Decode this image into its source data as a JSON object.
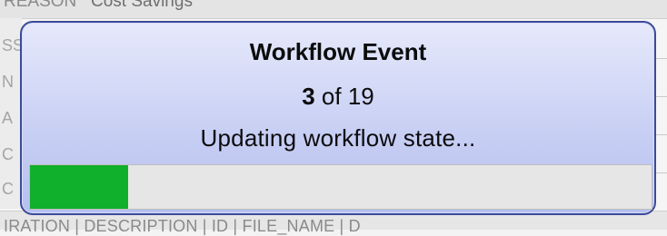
{
  "background": {
    "top_bar_fragments": [
      "REASON",
      "Cost Savings"
    ],
    "left_column_letters": [
      "SS",
      "N",
      "A",
      "C",
      "C"
    ],
    "bottom_columns_text": "IRATION | DESCRIPTION | ID | FILE_NAME | D"
  },
  "dialog": {
    "title": "Workflow Event",
    "current": "3",
    "of_text": " of ",
    "total": "19",
    "status": "Updating workflow state...",
    "progress_fraction": 0.15789,
    "colors": {
      "border": "#3c4a9a",
      "fill": "#10b02c",
      "track": "#e6e6e6"
    }
  }
}
